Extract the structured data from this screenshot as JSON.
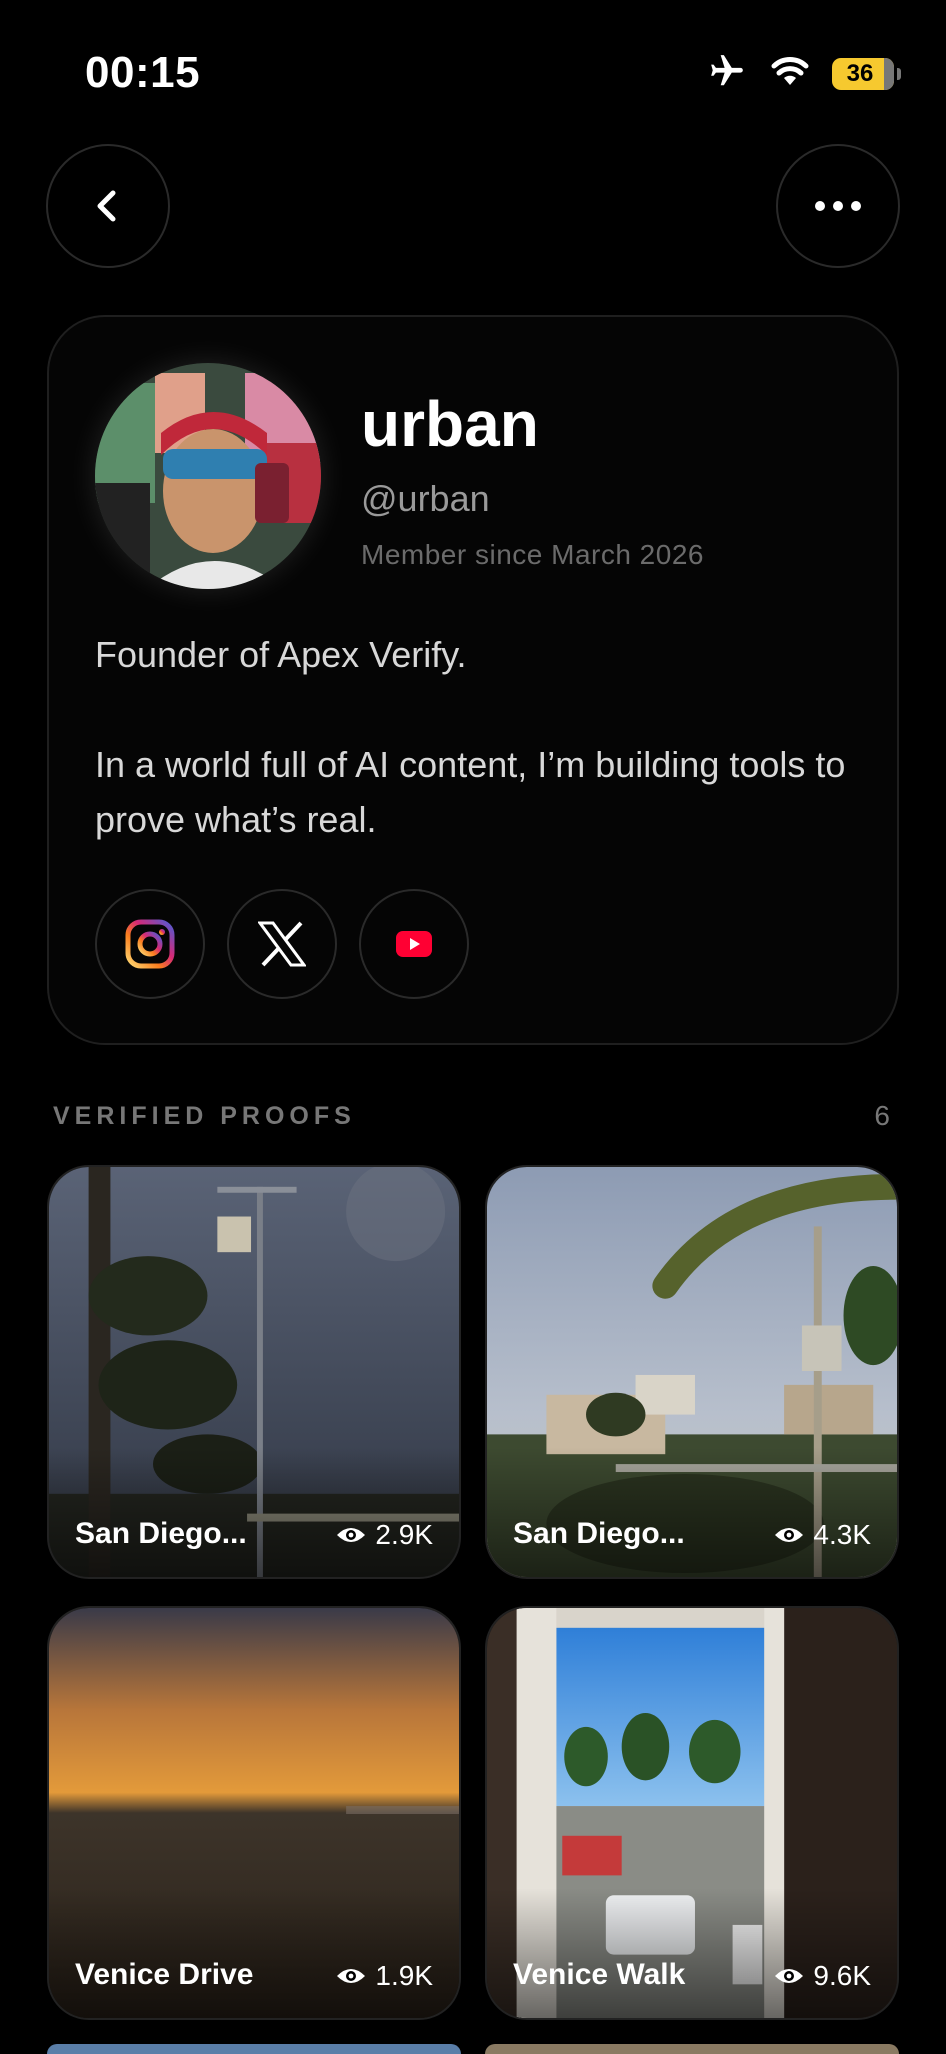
{
  "status_bar": {
    "time": "00:15",
    "battery": "36",
    "icons": [
      "airplane-icon",
      "wifi-icon",
      "battery-icon"
    ]
  },
  "nav": {
    "back_icon": "chevron-left-icon",
    "more_icon": "ellipsis-icon"
  },
  "profile": {
    "name": "urban",
    "handle": "@urban",
    "member_since": "Member since March 2026",
    "bio_line1": "Founder of Apex Verify.",
    "bio_line2": "In a world full of AI content, I’m building tools to prove what’s real.",
    "socials": [
      "instagram-icon",
      "x-icon",
      "youtube-icon"
    ]
  },
  "proofs": {
    "section_title": "VERIFIED PROOFS",
    "count": "6",
    "items": [
      {
        "title": "San Diego...",
        "views": "2.9K"
      },
      {
        "title": "San Diego...",
        "views": "4.3K"
      },
      {
        "title": "Venice Drive",
        "views": "1.9K"
      },
      {
        "title": "Venice Walk",
        "views": "9.6K"
      }
    ]
  },
  "colors": {
    "background": "#000000",
    "battery": "#f6c92f",
    "youtube": "#ff0033"
  }
}
